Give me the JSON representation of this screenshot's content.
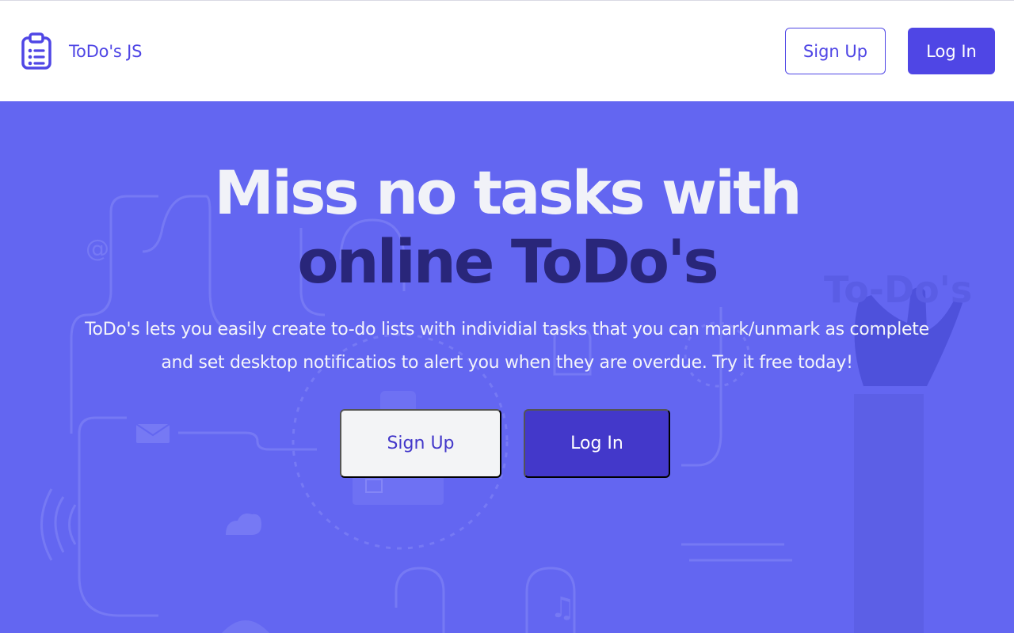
{
  "navbar": {
    "brand_name": "ToDo's JS",
    "brand_icon": "clipboard-list-icon",
    "signup_label": "Sign Up",
    "login_label": "Log In"
  },
  "hero": {
    "headline_line1": "Miss no tasks with",
    "headline_line2": "online ToDo's",
    "description_line1": "ToDo's lets you easily create to-do lists with individial tasks that you can mark/unmark as complete",
    "description_line2": "and set desktop notificatios to alert you when they are overdue. Try it free today!",
    "signup_label": "Sign Up",
    "login_label": "Log In",
    "background_illustration_text": "To-Do's"
  },
  "colors": {
    "brand": "#4f46e5",
    "hero_background": "#6366f1",
    "headline_light": "#f1f2f8",
    "headline_dark": "#29267a",
    "button_dark": "#4338ca"
  }
}
